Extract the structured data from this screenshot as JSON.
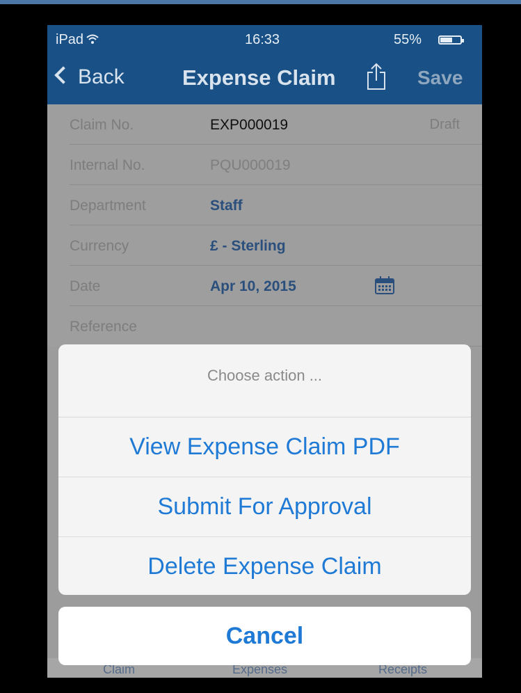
{
  "status_bar": {
    "carrier": "iPad",
    "time": "16:33",
    "battery": "55%"
  },
  "nav": {
    "back_label": "Back",
    "title": "Expense Claim",
    "save_label": "Save"
  },
  "form": {
    "rows": [
      {
        "label": "Claim No.",
        "value": "EXP000019",
        "status": "Draft"
      },
      {
        "label": "Internal No.",
        "value": "PQU000019"
      },
      {
        "label": "Department",
        "value": "Staff"
      },
      {
        "label": "Currency",
        "value": "£ - Sterling"
      },
      {
        "label": "Date",
        "value": "Apr 10, 2015"
      },
      {
        "label": "Reference",
        "value": ""
      }
    ]
  },
  "action_sheet": {
    "title": "Choose action ...",
    "items": [
      "View Expense Claim PDF",
      "Submit For Approval",
      "Delete Expense Claim"
    ],
    "cancel": "Cancel"
  },
  "tab_bar": {
    "tabs": [
      "Claim",
      "Expenses",
      "Receipts"
    ]
  },
  "colors": {
    "nav_bar": "#195085",
    "action_text": "#1f7ad6",
    "dim_overlay": "#9c9c9c"
  }
}
